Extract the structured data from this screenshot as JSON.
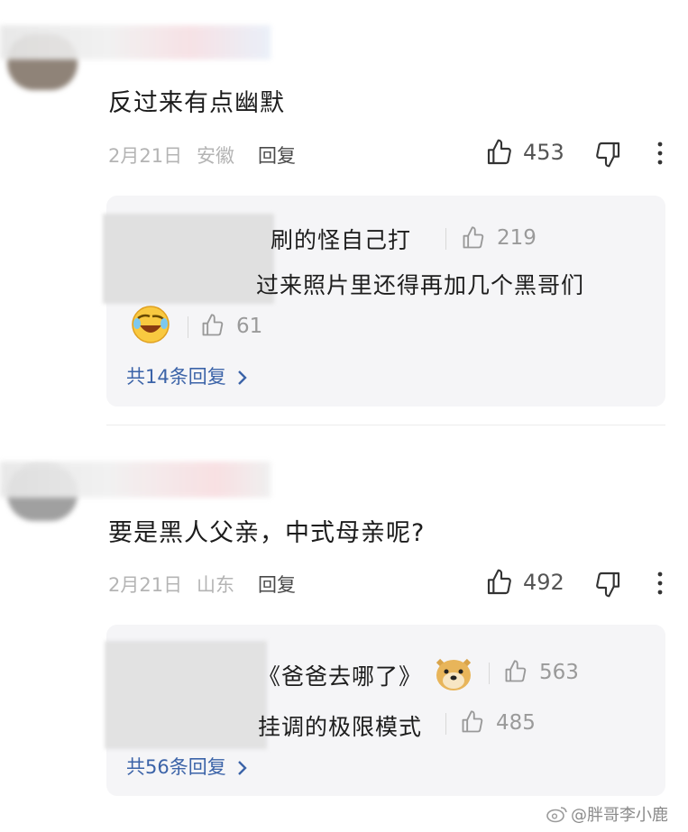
{
  "comments": [
    {
      "text": "反过来有点幽默",
      "date": "2月21日",
      "location": "安徽",
      "reply_label": "回复",
      "likes": "453",
      "replies": [
        {
          "text": "刷的怪自己打",
          "likes": "219"
        },
        {
          "text": "过来照片里还得再加几个黑哥们"
        },
        {
          "likes": "61"
        }
      ],
      "more_replies": "共14条回复"
    },
    {
      "text": "要是黑人父亲，中式母亲呢?",
      "date": "2月21日",
      "location": "山东",
      "reply_label": "回复",
      "likes": "492",
      "replies": [
        {
          "text": "《爸爸去哪了》",
          "likes": "563"
        },
        {
          "text": "挂调的极限模式",
          "likes": "485"
        }
      ],
      "more_replies": "共56条回复"
    }
  ],
  "watermark": "@胖哥李小鹿",
  "icons": [
    "thumbs-up-icon",
    "thumbs-down-icon",
    "more-vertical-icon",
    "chevron-right-icon",
    "laughing-emoji-icon",
    "doge-emoji-icon",
    "weibo-logo-icon"
  ]
}
